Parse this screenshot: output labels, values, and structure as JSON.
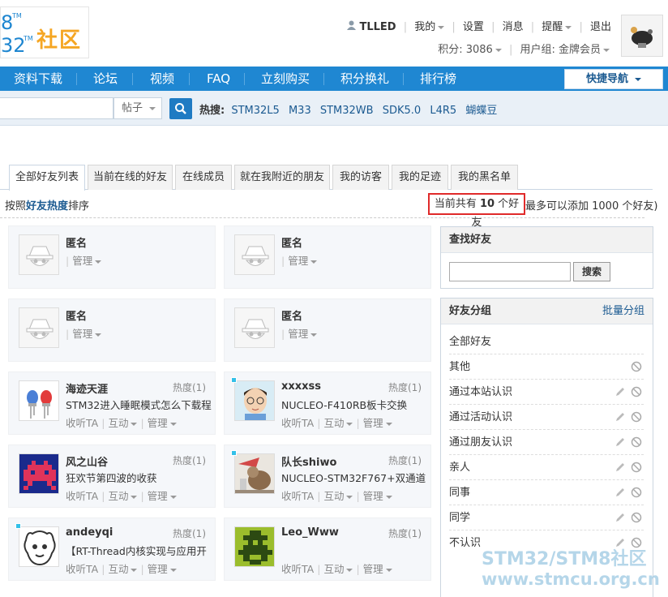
{
  "logo": {
    "line1": "8",
    "line2": "32",
    "tm": "TM",
    "community": "社区"
  },
  "user": {
    "username": "TLLED",
    "my": "我的",
    "settings": "设置",
    "messages": "消息",
    "remind": "提醒",
    "logout": "退出",
    "points": "积分: 3086",
    "group": "用户组: 金牌会员"
  },
  "nav": {
    "items": [
      "资料下载",
      "论坛",
      "视频",
      "FAQ",
      "立刻购买",
      "积分换礼",
      "排行榜"
    ],
    "quick_nav": "快捷导航"
  },
  "search": {
    "type": "帖子",
    "hot_label": "热搜:",
    "hot": [
      "STM32L5",
      "M33",
      "STM32WB",
      "SDK5.0",
      "L4R5",
      "蝴蝶豆"
    ]
  },
  "tabs": [
    "全部好友列表",
    "当前在线的好友",
    "在线成员",
    "就在我附近的朋友",
    "我的访客",
    "我的足迹",
    "我的黑名单"
  ],
  "sort": {
    "prefix": "按照",
    "key": "好友热度",
    "suffix": "排序"
  },
  "count": {
    "prefix": "当前共有 ",
    "num": "10",
    "suffix": " 个好友",
    "tail": "最多可以添加 1000 个好友)"
  },
  "friends": [
    {
      "name": "匿名",
      "heat": "",
      "sig": "",
      "acts": [
        "管理"
      ]
    },
    {
      "name": "匿名",
      "heat": "",
      "sig": "",
      "acts": [
        "管理"
      ]
    },
    {
      "name": "匿名",
      "heat": "",
      "sig": "",
      "acts": [
        "管理"
      ]
    },
    {
      "name": "匿名",
      "heat": "",
      "sig": "",
      "acts": [
        "管理"
      ]
    },
    {
      "name": "海迹天涯",
      "heat": "热度(1)",
      "sig": "STM32进入睡眠模式怎么下载程",
      "acts": [
        "收听TA",
        "互动",
        "管理"
      ]
    },
    {
      "name": "xxxxss",
      "heat": "热度(1)",
      "sig": "NUCLEO-F410RB板卡交换",
      "acts": [
        "收听TA",
        "互动",
        "管理"
      ]
    },
    {
      "name": "风之山谷",
      "heat": "热度(1)",
      "sig": "狂欢节第四波的收获",
      "acts": [
        "收听TA",
        "互动",
        "管理"
      ]
    },
    {
      "name": "队长shiwo",
      "heat": "热度(1)",
      "sig": "NUCLEO-STM32F767+双通道",
      "acts": [
        "收听TA",
        "互动",
        "管理"
      ]
    },
    {
      "name": "andeyqi",
      "heat": "热度(1)",
      "sig": "【RT-Thread内核实现与应用开",
      "acts": [
        "收听TA",
        "互动",
        "管理"
      ]
    },
    {
      "name": "Leo_Www",
      "heat": "热度(1)",
      "sig": "",
      "acts": [
        "收听TA",
        "互动",
        "管理"
      ]
    }
  ],
  "find": {
    "title": "查找好友",
    "button": "搜索"
  },
  "groups": {
    "title": "好友分组",
    "batch": "批量分组",
    "items": [
      "全部好友",
      "其他",
      "通过本站认识",
      "通过活动认识",
      "通过朋友认识",
      "亲人",
      "同事",
      "同学",
      "不认识"
    ]
  },
  "watermark": {
    "line1": "STM32/STM8社区",
    "line2": "www.stmcu.org.cn"
  }
}
